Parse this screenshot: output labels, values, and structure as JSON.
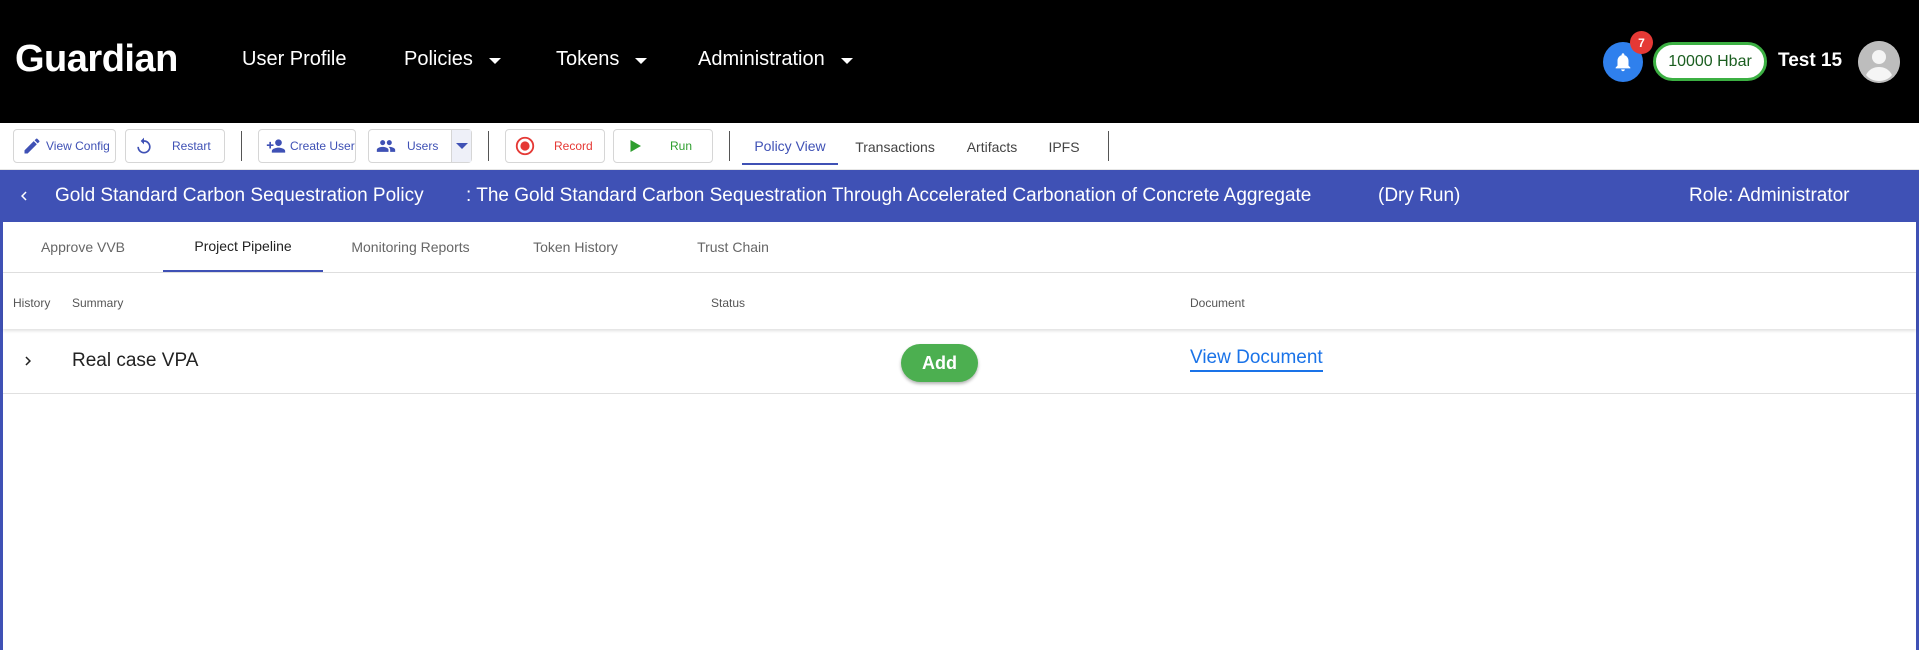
{
  "header": {
    "logo": "Guardian",
    "nav": [
      {
        "label": "User Profile",
        "dropdown": false
      },
      {
        "label": "Policies",
        "dropdown": true
      },
      {
        "label": "Tokens",
        "dropdown": true
      },
      {
        "label": "Administration",
        "dropdown": true
      }
    ],
    "notifications_count": "7",
    "balance": "10000 Hbar",
    "username": "Test 15"
  },
  "toolbar": {
    "view_config": "View Config",
    "restart": "Restart",
    "create_user": "Create User",
    "users": "Users",
    "record": "Record",
    "run": "Run",
    "tabs": [
      "Policy View",
      "Transactions",
      "Artifacts",
      "IPFS"
    ],
    "active_tab": "Policy View"
  },
  "policy_bar": {
    "name": "Gold Standard Carbon Sequestration Policy",
    "description": ": The Gold Standard Carbon Sequestration Through Accelerated Carbonation of Concrete Aggregate",
    "mode": "(Dry Run)",
    "role": "Role: Administrator"
  },
  "subtabs": [
    "Approve VVB",
    "Project Pipeline",
    "Monitoring Reports",
    "Token History",
    "Trust Chain"
  ],
  "active_subtab": "Project Pipeline",
  "table": {
    "columns": [
      "History",
      "Summary",
      "Status",
      "Document"
    ],
    "rows": [
      {
        "summary": "Real case VPA",
        "status_button": "Add",
        "document_link": "View Document"
      }
    ]
  },
  "colors": {
    "header_bg": "#000000",
    "accent": "#3f51b5",
    "status_green": "#4caf50",
    "record_red": "#e53935",
    "run_green": "#2e9e2e",
    "link_blue": "#1a73e8"
  }
}
